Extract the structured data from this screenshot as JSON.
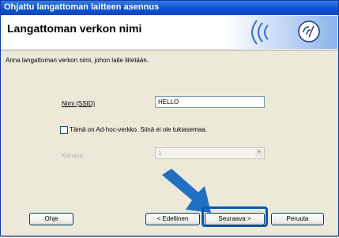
{
  "window": {
    "title": "Ohjattu langattoman laitteen asennus"
  },
  "header": {
    "title": "Langattoman verkon nimi",
    "logo_icon": "wifi-logo-icon"
  },
  "instructions": "Anna langattoman verkon nimi, johon laite liitetään.",
  "ssid": {
    "label": "Nimi (SSID)",
    "value": "HELLO"
  },
  "adhoc": {
    "label": "Tämä on Ad-hoc-verkko. Siinä ei ole tukiasemaa.",
    "checked": false
  },
  "channel": {
    "label": "Kanava",
    "value": "1"
  },
  "buttons": {
    "help": "Ohje",
    "back": "< Edellinen",
    "next": "Seuraava >",
    "cancel": "Peruuta"
  },
  "colors": {
    "accent": "#0059b3",
    "arrow": "#1f6fc2",
    "titlebar": "#0f55d2"
  }
}
